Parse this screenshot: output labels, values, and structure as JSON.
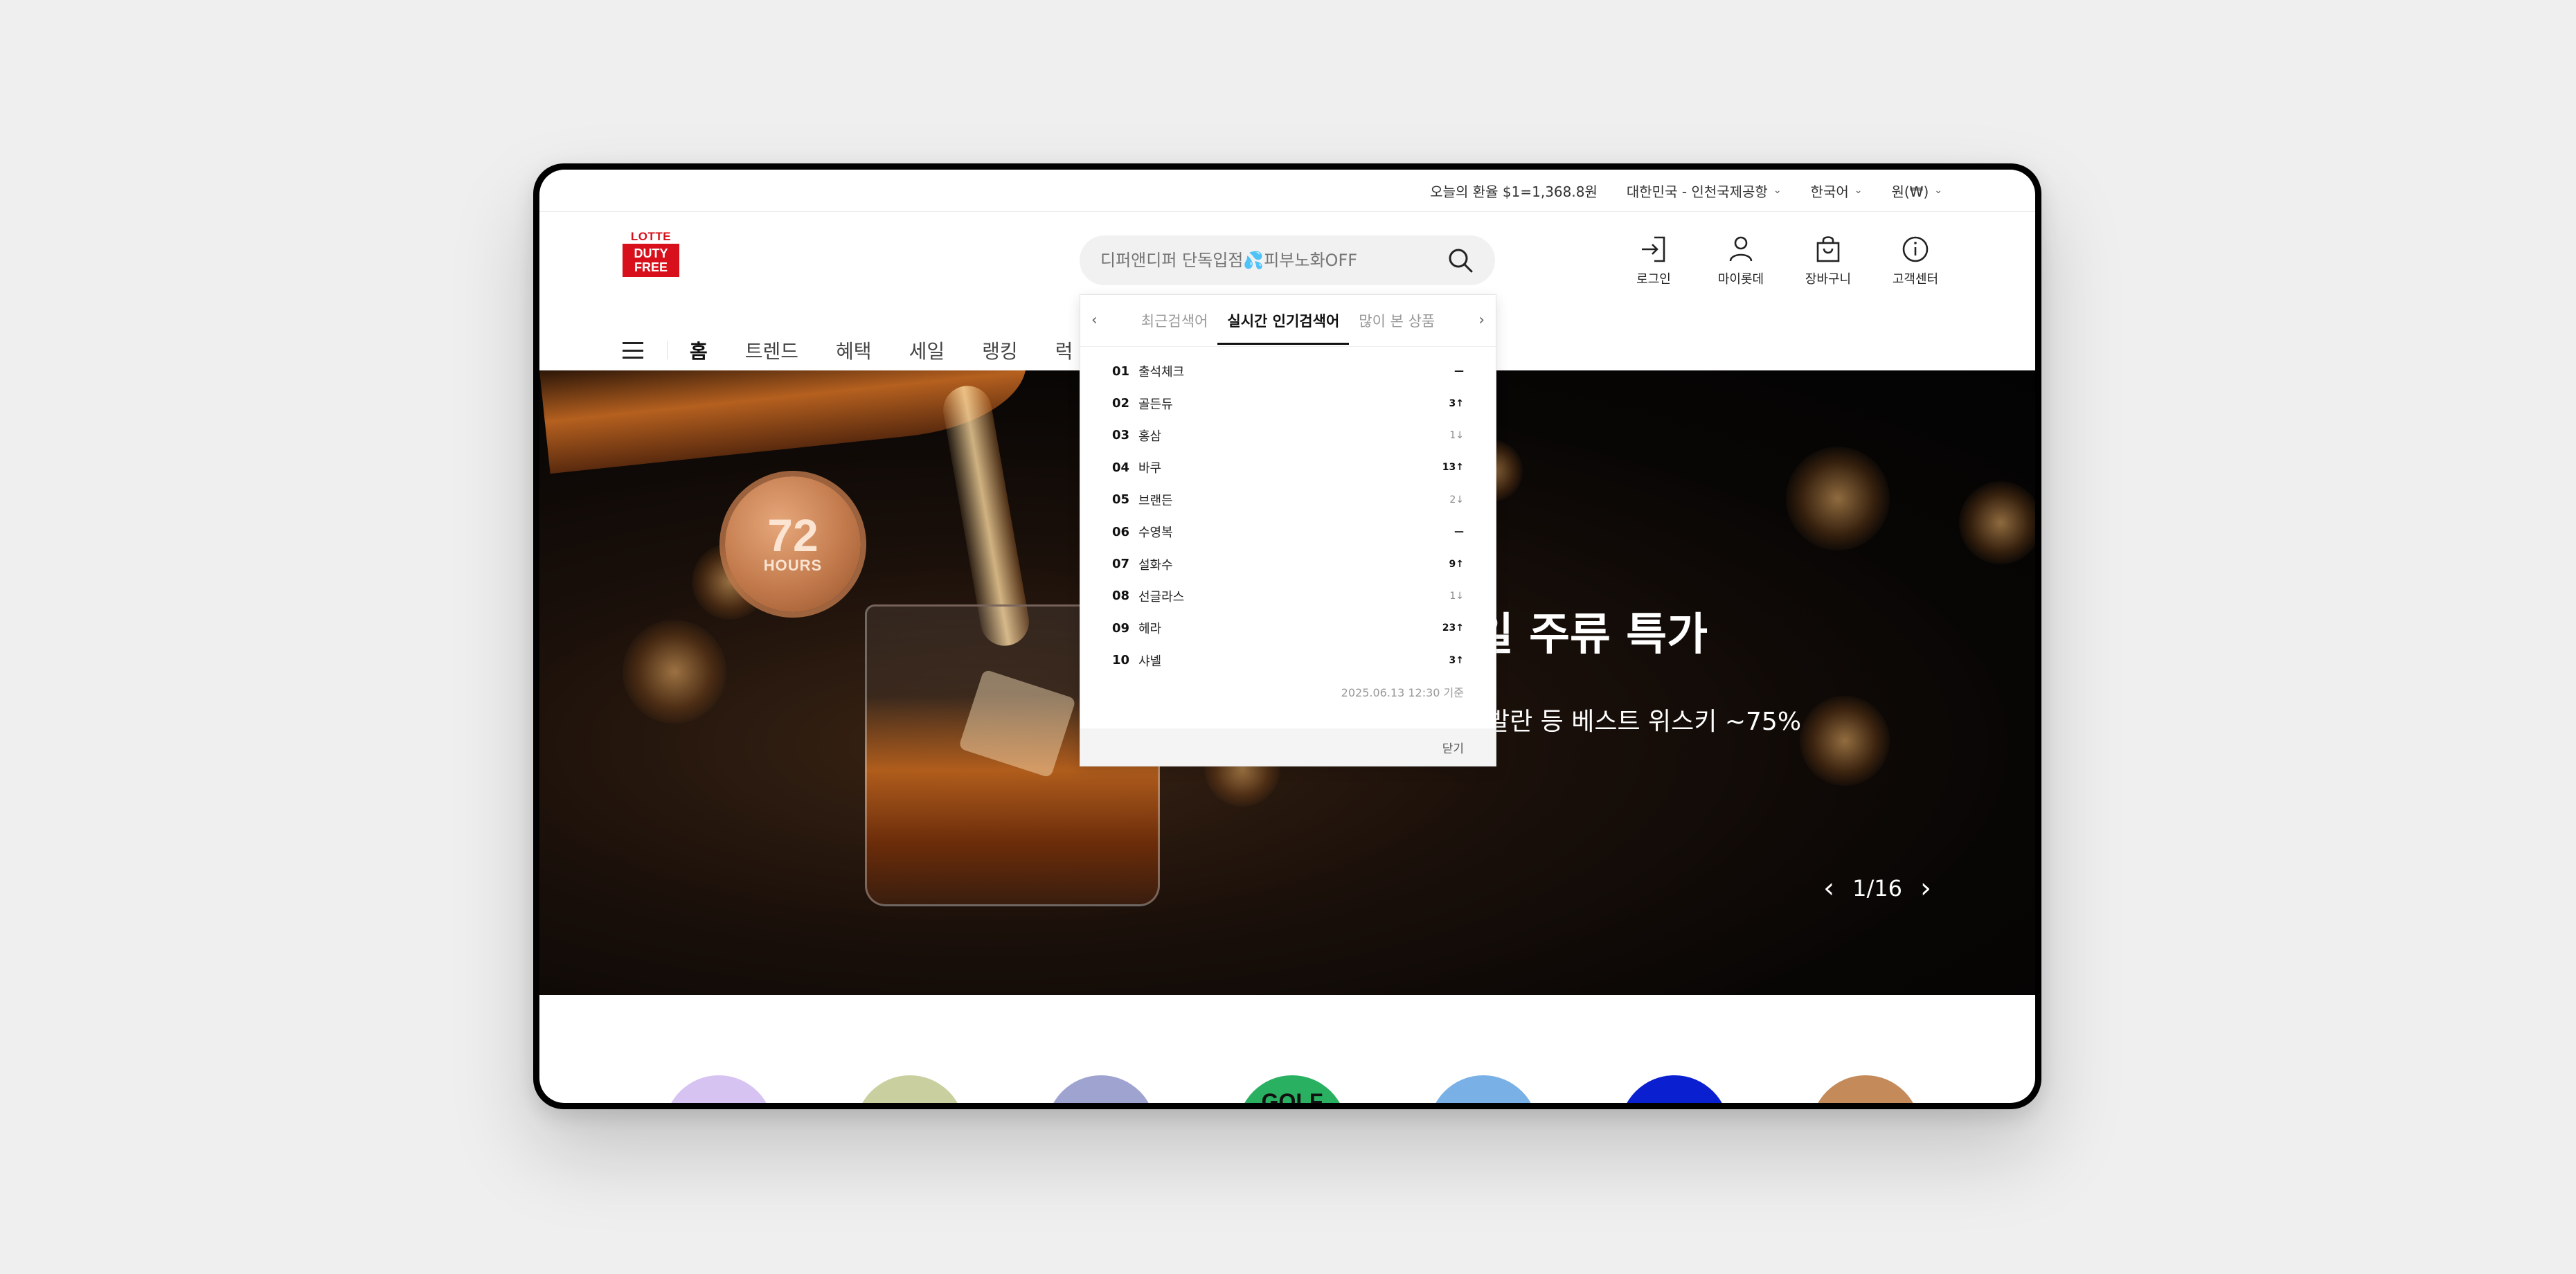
{
  "util_bar": {
    "exchange": "오늘의 환율 $1=1,368.8원",
    "location": "대한민국 - 인천국제공항",
    "language": "한국어",
    "currency": "원(₩)"
  },
  "header": {
    "logo_top": "LOTTE",
    "logo_line1": "DUTY",
    "logo_line2": "FREE",
    "search_placeholder": "디퍼앤디퍼 단독입점💦피부노화OFF",
    "icons": [
      {
        "label": "로그인",
        "icon": "login-icon"
      },
      {
        "label": "마이롯데",
        "icon": "user-icon"
      },
      {
        "label": "장바구니",
        "icon": "cart-icon"
      },
      {
        "label": "고객센터",
        "icon": "info-icon"
      }
    ]
  },
  "nav": {
    "tabs": [
      "홈",
      "트렌드",
      "혜택",
      "세일",
      "랭킹",
      "럭"
    ],
    "active": "홈"
  },
  "banner": {
    "badge_number": "72",
    "badge_text": "HOURS",
    "title": "일 주류 특가",
    "subtitle": "발란 등 베스트 위스키 ~75%",
    "pager": "1/16"
  },
  "categories": [
    {
      "label": "",
      "color": "#d6c3f2"
    },
    {
      "label": "",
      "color": "#c9cf9e"
    },
    {
      "label": "",
      "color": "#9ea4cf"
    },
    {
      "label": "GOLF",
      "color": "#29b061"
    },
    {
      "label": "",
      "color": "#79b0e6"
    },
    {
      "label": "",
      "color": "#0a1fd0"
    },
    {
      "label": "",
      "color": "#c48a5a"
    }
  ],
  "popular_search": {
    "tabs": [
      "최근검색어",
      "실시간 인기검색어",
      "많이 본 상품"
    ],
    "active_tab": "실시간 인기검색어",
    "items": [
      {
        "rank": "01",
        "keyword": "출석체크",
        "change": "—",
        "dir": "none"
      },
      {
        "rank": "02",
        "keyword": "골든듀",
        "change": "3↑",
        "dir": "up"
      },
      {
        "rank": "03",
        "keyword": "홍삼",
        "change": "1↓",
        "dir": "down"
      },
      {
        "rank": "04",
        "keyword": "바쿠",
        "change": "13↑",
        "dir": "up"
      },
      {
        "rank": "05",
        "keyword": "브랜든",
        "change": "2↓",
        "dir": "down"
      },
      {
        "rank": "06",
        "keyword": "수영복",
        "change": "—",
        "dir": "none"
      },
      {
        "rank": "07",
        "keyword": "설화수",
        "change": "9↑",
        "dir": "up"
      },
      {
        "rank": "08",
        "keyword": "선글라스",
        "change": "1↓",
        "dir": "down"
      },
      {
        "rank": "09",
        "keyword": "헤라",
        "change": "23↑",
        "dir": "up"
      },
      {
        "rank": "10",
        "keyword": "샤넬",
        "change": "3↑",
        "dir": "up"
      }
    ],
    "timestamp": "2025.06.13 12:30 기준",
    "close_label": "닫기"
  }
}
